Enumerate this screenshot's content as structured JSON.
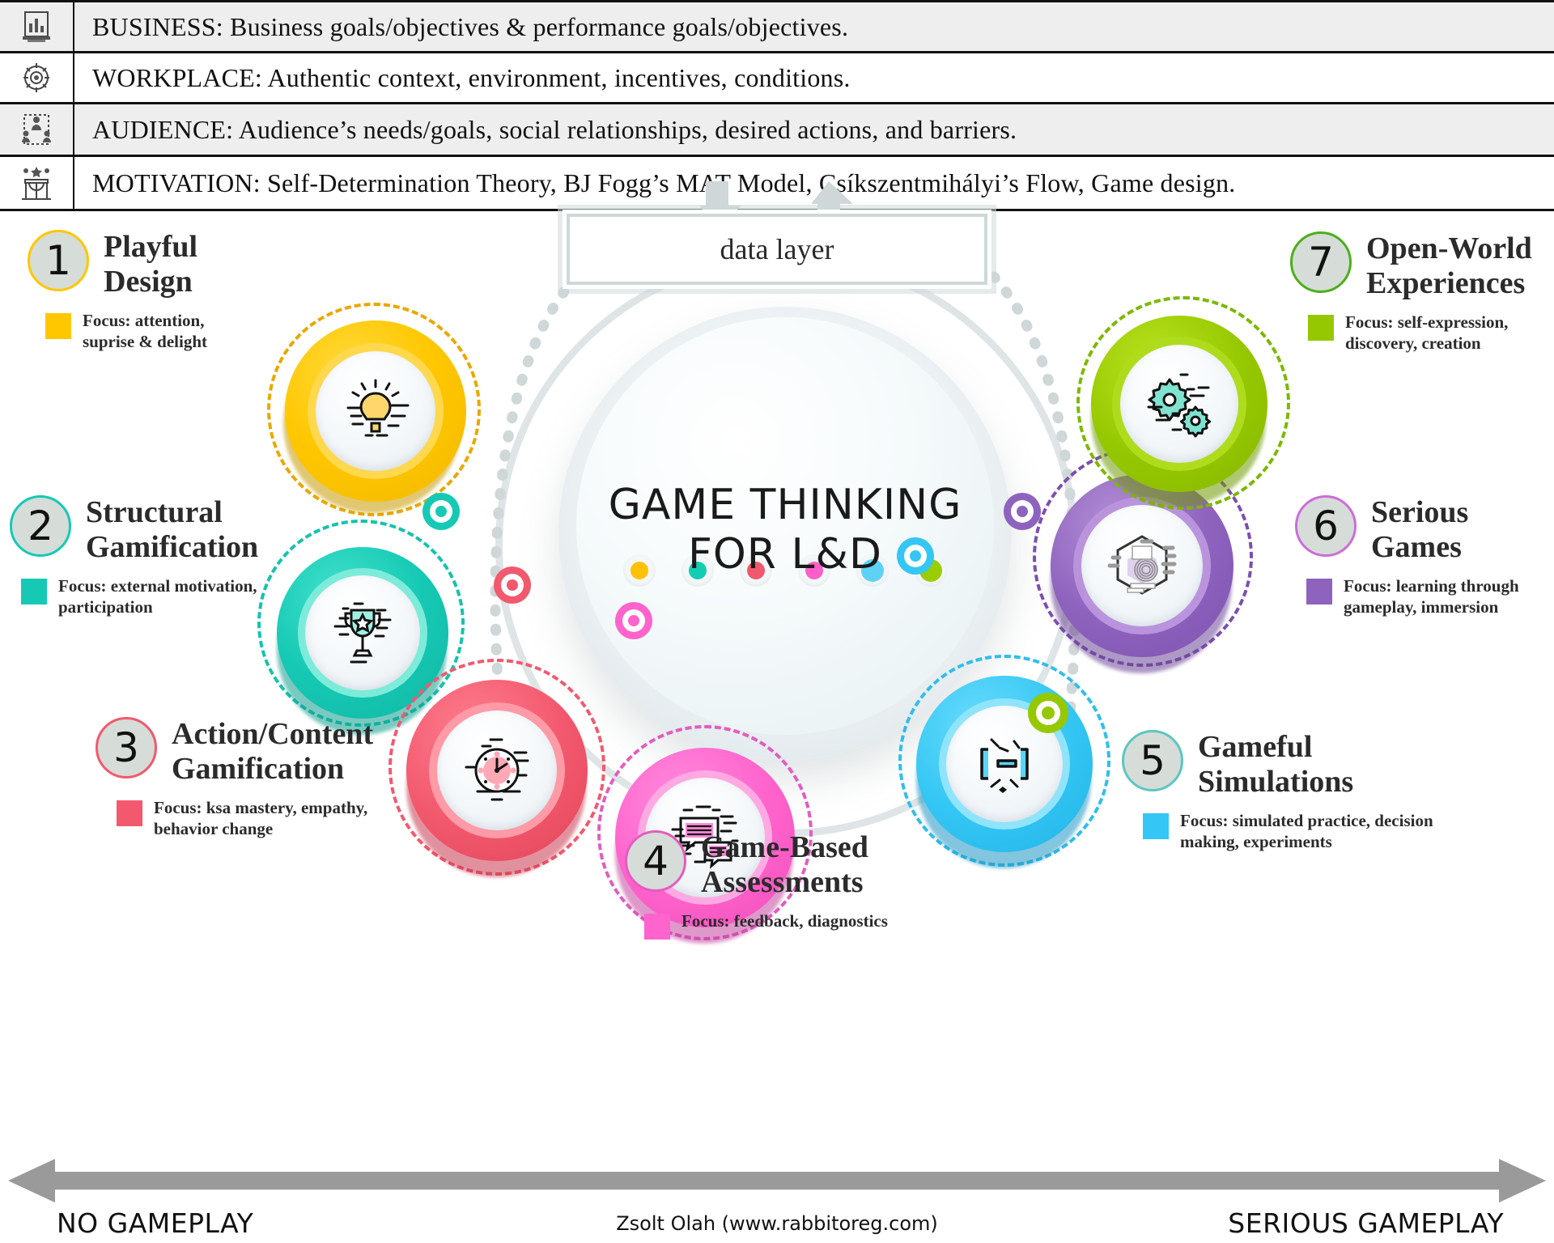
{
  "banner": {
    "rows": [
      {
        "icon": "bank-chart-icon",
        "label": "BUSINESS: Business goals/objectives & performance goals/objectives."
      },
      {
        "icon": "gear-settings-icon",
        "label": "WORKPLACE: Authentic context,  environment, incentives, conditions."
      },
      {
        "icon": "audience-network-icon",
        "label": "AUDIENCE: Audience’s needs/goals, social relationships, desired actions, and barriers."
      },
      {
        "icon": "motivation-podium-icon",
        "label": "MOTIVATION: Self-Determination Theory, BJ Fogg’s MAT Model, Csíkszentmihályi’s Flow, Game design."
      }
    ]
  },
  "center": {
    "data_layer_label": "data layer",
    "title_line1": "GAME THINKING",
    "title_line2": "FOR L&D",
    "dot_colors": [
      "#FFC107",
      "#12CDB4",
      "#F0596B",
      "#FF5FC8",
      "#5DD2F5",
      "#9ACD00"
    ]
  },
  "nodes": [
    {
      "number": "1",
      "title_line1": "Playful",
      "title_line2": "Design",
      "focus": "Focus: attention, suprise & delight",
      "color": "#FFC700",
      "dash": "#E8A800",
      "icon": "lightbulb-icon"
    },
    {
      "number": "2",
      "title_line1": "Structural",
      "title_line2": "Gamification",
      "focus": "Focus: external motivation, participation",
      "color": "#16C9B4",
      "dash": "#14C2AE",
      "icon": "trophy-icon"
    },
    {
      "number": "3",
      "title_line1": "Action/Content",
      "title_line2": "Gamification",
      "focus": "Focus: ksa mastery, empathy, behavior change",
      "color": "#F2596E",
      "dash": "#F2596E",
      "icon": "clock-icon"
    },
    {
      "number": "4",
      "title_line1": "Game-Based",
      "title_line2": "Assessments",
      "focus": "Focus: feedback, diagnostics",
      "color": "#FF63CC",
      "dash": "#E25CC0",
      "icon": "chat-documents-icon"
    },
    {
      "number": "5",
      "title_line1": "Gameful",
      "title_line2": "Simulations",
      "focus": "Focus: simulated practice, decision making, experiments",
      "color": "#34C6F4",
      "dash": "#2FBEEC",
      "icon": "focus-brackets-icon"
    },
    {
      "number": "6",
      "title_line1": "Serious",
      "title_line2": "Games",
      "focus": "Focus: learning through gameplay, immersion",
      "color": "#8E63BE",
      "dash": "#7B4FAE",
      "icon": "hexagon-target-icon"
    },
    {
      "number": "7",
      "title_line1": "Open-World",
      "title_line2": "Experiences",
      "focus": "Focus: self-expression, discovery, creation",
      "color": "#96C800",
      "dash": "#7DB800",
      "icon": "gears-icon"
    }
  ],
  "axis": {
    "left_label": "NO GAMEPLAY",
    "right_label": "SERIOUS GAMEPLAY",
    "credit": "Zsolt Olah (www.rabbitoreg.com)"
  }
}
